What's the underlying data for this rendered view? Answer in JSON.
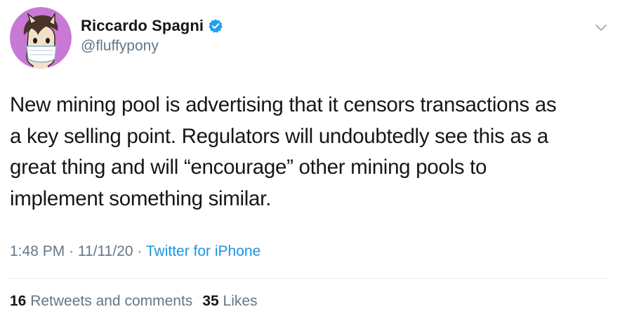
{
  "author": {
    "display_name": "Riccardo Spagni",
    "handle": "@fluffypony",
    "verified": true,
    "avatar": "pony-with-mask-avatar"
  },
  "tweet": {
    "text_lines": [
      "New mining pool is advertising that it censors transactions as",
      "a key selling point. Regulators will undoubtedly see this as a",
      "great thing and will “encourage” other mining pools to",
      "implement something similar."
    ],
    "time": "1:48 PM",
    "separator": "·",
    "date": "11/11/20",
    "source": "Twitter for iPhone"
  },
  "stats": {
    "retweets_count": "16",
    "retweets_label": "Retweets and comments",
    "likes_count": "35",
    "likes_label": "Likes"
  },
  "icons": {
    "verified": "verified-badge-icon",
    "menu": "chevron-down-icon"
  },
  "colors": {
    "text": "#14171a",
    "secondary": "#657786",
    "link": "#1b95e0",
    "verified": "#1da1f2",
    "avatar_bg": "#c978d6"
  }
}
